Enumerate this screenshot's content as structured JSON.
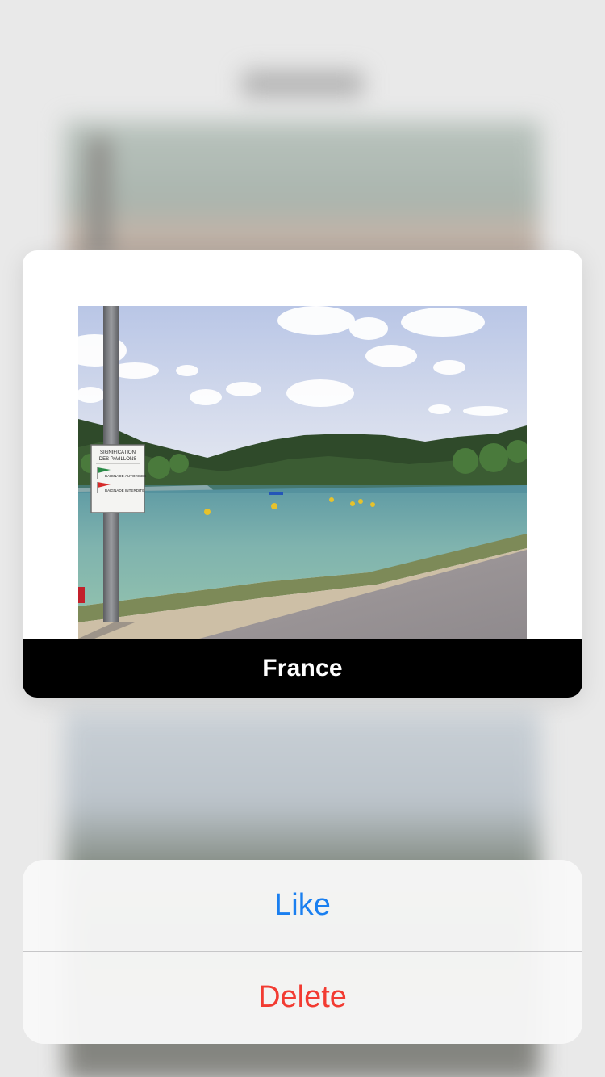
{
  "peek": {
    "caption": "France",
    "photo_icon": "landscape-photo",
    "sign": {
      "title_line1": "SIGNIFICATION",
      "title_line2": "DES PAVILLONS",
      "line1": "BAIGNADE AUTORISEE",
      "line2": "BAIGNADE INTERDITE"
    }
  },
  "actions": {
    "like_label": "Like",
    "delete_label": "Delete"
  },
  "colors": {
    "like": "#1a7ff0",
    "delete": "#f23b32",
    "caption_bg": "#000000"
  }
}
